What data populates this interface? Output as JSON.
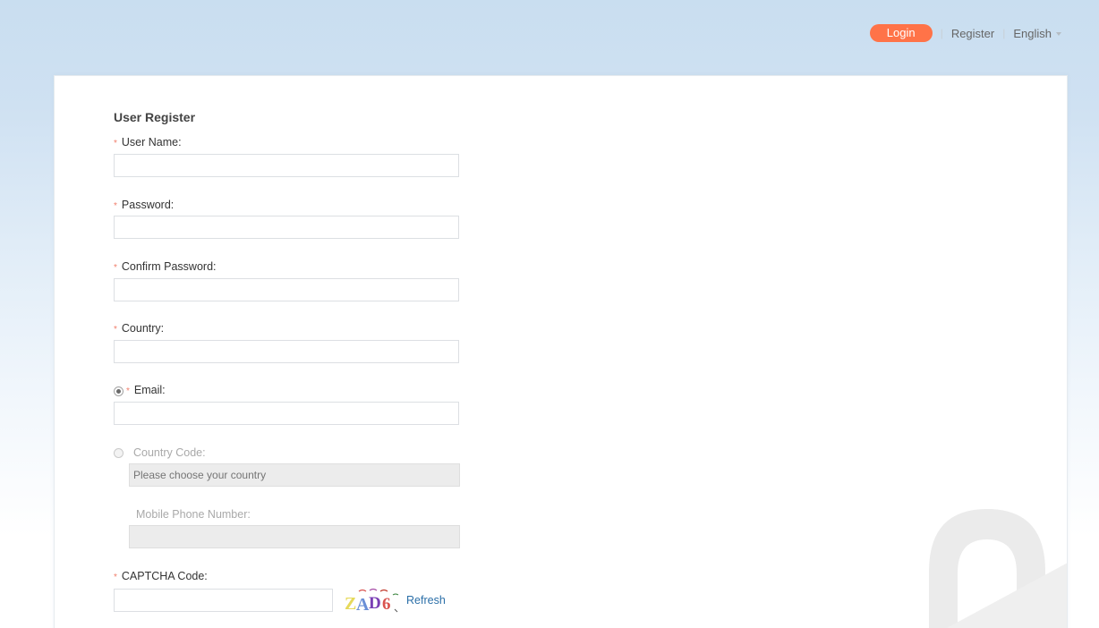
{
  "header": {
    "login_label": "Login",
    "register_label": "Register",
    "language_label": "English",
    "separator": "|"
  },
  "form": {
    "title": "User Register",
    "required_mark": "*",
    "username": {
      "label": "User Name:",
      "value": ""
    },
    "password": {
      "label": "Password:",
      "value": ""
    },
    "confirm_password": {
      "label": "Confirm Password:",
      "value": ""
    },
    "country": {
      "label": "Country:",
      "value": ""
    },
    "email": {
      "label": "Email:",
      "value": "",
      "selected": true
    },
    "country_code": {
      "label": "Country Code:",
      "placeholder": "Please choose your country",
      "selected": false,
      "disabled": true
    },
    "mobile": {
      "label": "Mobile Phone Number:",
      "value": "",
      "disabled": true
    },
    "captcha": {
      "label": "CAPTCHA Code:",
      "value": "",
      "image_text": "ZAD6",
      "refresh_label": "Refresh"
    }
  },
  "colors": {
    "login_button": "#ff7348",
    "required_mark": "#f17e6b",
    "link": "#2b6fa8",
    "background_top": "#c9def0"
  }
}
